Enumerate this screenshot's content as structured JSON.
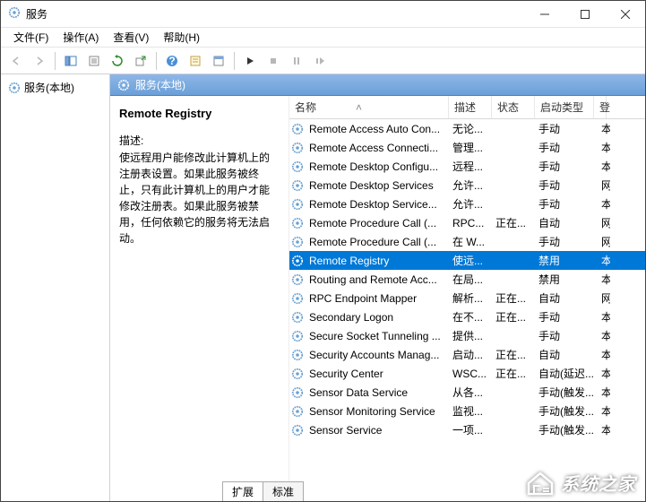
{
  "window": {
    "title": "服务"
  },
  "menu": {
    "file": "文件(F)",
    "action": "操作(A)",
    "view": "查看(V)",
    "help": "帮助(H)"
  },
  "tree": {
    "root": "服务(本地)"
  },
  "panel": {
    "header": "服务(本地)"
  },
  "detail": {
    "name": "Remote Registry",
    "desc_label": "描述:",
    "desc": "使远程用户能修改此计算机上的注册表设置。如果此服务被终止，只有此计算机上的用户才能修改注册表。如果此服务被禁用，任何依赖它的服务将无法启动。"
  },
  "columns": {
    "name": "名称",
    "desc": "描述",
    "status": "状态",
    "startup": "启动类型",
    "last": "登"
  },
  "sort_indicator": "˄",
  "services": [
    {
      "name": "Remote Access Auto Con...",
      "desc": "无论...",
      "status": "",
      "startup": "手动",
      "last": "本"
    },
    {
      "name": "Remote Access Connecti...",
      "desc": "管理...",
      "status": "",
      "startup": "手动",
      "last": "本"
    },
    {
      "name": "Remote Desktop Configu...",
      "desc": "远程...",
      "status": "",
      "startup": "手动",
      "last": "本"
    },
    {
      "name": "Remote Desktop Services",
      "desc": "允许...",
      "status": "",
      "startup": "手动",
      "last": "网"
    },
    {
      "name": "Remote Desktop Service...",
      "desc": "允许...",
      "status": "",
      "startup": "手动",
      "last": "本"
    },
    {
      "name": "Remote Procedure Call (...",
      "desc": "RPC...",
      "status": "正在...",
      "startup": "自动",
      "last": "网"
    },
    {
      "name": "Remote Procedure Call (...",
      "desc": "在 W...",
      "status": "",
      "startup": "手动",
      "last": "网"
    },
    {
      "name": "Remote Registry",
      "desc": "使远...",
      "status": "",
      "startup": "禁用",
      "last": "本",
      "selected": true
    },
    {
      "name": "Routing and Remote Acc...",
      "desc": "在局...",
      "status": "",
      "startup": "禁用",
      "last": "本"
    },
    {
      "name": "RPC Endpoint Mapper",
      "desc": "解析...",
      "status": "正在...",
      "startup": "自动",
      "last": "网"
    },
    {
      "name": "Secondary Logon",
      "desc": "在不...",
      "status": "正在...",
      "startup": "手动",
      "last": "本"
    },
    {
      "name": "Secure Socket Tunneling ...",
      "desc": "提供...",
      "status": "",
      "startup": "手动",
      "last": "本"
    },
    {
      "name": "Security Accounts Manag...",
      "desc": "启动...",
      "status": "正在...",
      "startup": "自动",
      "last": "本"
    },
    {
      "name": "Security Center",
      "desc": "WSC...",
      "status": "正在...",
      "startup": "自动(延迟...",
      "last": "本"
    },
    {
      "name": "Sensor Data Service",
      "desc": "从各...",
      "status": "",
      "startup": "手动(触发...",
      "last": "本"
    },
    {
      "name": "Sensor Monitoring Service",
      "desc": "监视...",
      "status": "",
      "startup": "手动(触发...",
      "last": "本"
    },
    {
      "name": "Sensor Service",
      "desc": "一项...",
      "status": "",
      "startup": "手动(触发...",
      "last": "本"
    }
  ],
  "tabs": {
    "extended": "扩展",
    "standard": "标准"
  },
  "watermark": "系统之家"
}
